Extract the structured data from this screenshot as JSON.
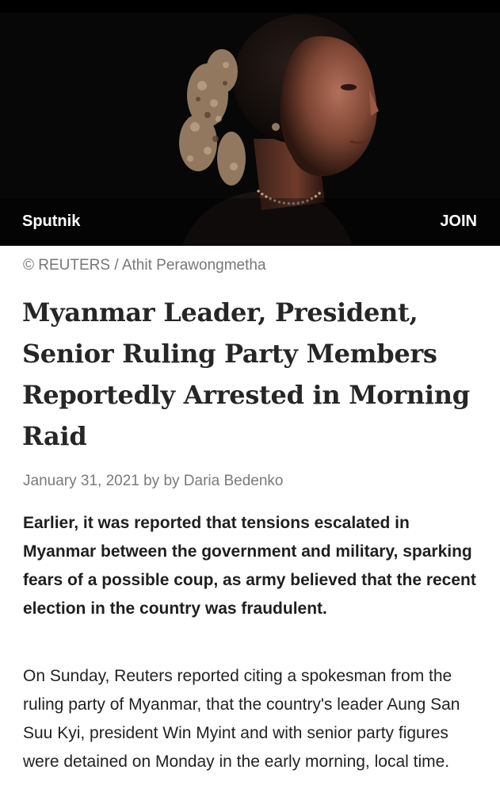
{
  "header": {
    "channel_name": "Sputnik",
    "join_label": "JOIN"
  },
  "photo": {
    "subject": "portrait photo of a woman with flowers in her hair on a black background"
  },
  "article": {
    "photo_credit": "© REUTERS / Athit Perawongmetha",
    "title": "Myanmar Leader, President, Senior Ruling Party Members Reportedly Arrested in Morning Raid",
    "byline": "January 31, 2021 by by Daria Bedenko",
    "lead": "Earlier, it was reported that tensions escalated in Myanmar between the government and military, sparking fears of a possible coup, as army believed that the recent election in the country was fraudulent.",
    "paragraph_1": "On Sunday, Reuters reported citing a spokesman from the ruling party of Myanmar, that the country's leader Aung San Suu Kyi, president Win Myint and with senior party figures were detained on Monday in the early morning, local time."
  }
}
